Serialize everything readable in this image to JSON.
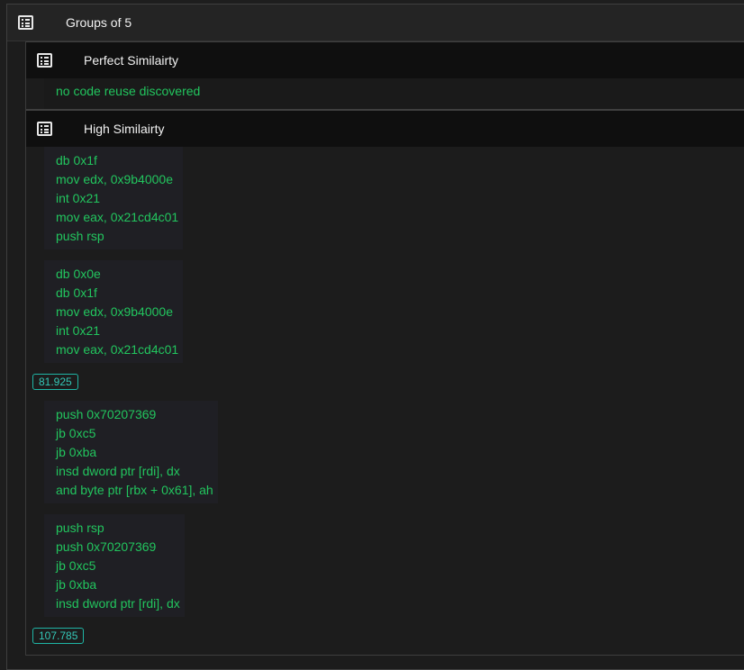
{
  "group": {
    "title": "Groups of 5"
  },
  "perfect": {
    "title": "Perfect Similairty",
    "empty_text": "no code reuse discovered"
  },
  "high": {
    "title": "High Similairty",
    "pairs": [
      {
        "a": [
          "db 0x1f",
          "mov edx, 0x9b4000e",
          "int 0x21",
          "mov eax, 0x21cd4c01",
          "push rsp"
        ],
        "b": [
          "db 0x0e",
          "db 0x1f",
          "mov edx, 0x9b4000e",
          "int 0x21",
          "mov eax, 0x21cd4c01"
        ],
        "score": "81.925"
      },
      {
        "a": [
          "push 0x70207369",
          "jb 0xc5",
          "jb 0xba",
          "insd dword ptr [rdi], dx",
          "and byte ptr [rbx + 0x61], ah"
        ],
        "b": [
          "push rsp",
          "push 0x70207369",
          "jb 0xc5",
          "jb 0xba",
          "insd dword ptr [rdi], dx"
        ],
        "score": "107.785"
      }
    ]
  },
  "icons": {
    "group_icon": "list-icon",
    "section_icon": "list-icon"
  },
  "colors": {
    "code_green": "#22c55e",
    "score_teal": "#34c7b7",
    "background": "#1c1c1c",
    "header_dark": "#0f0f0f"
  }
}
